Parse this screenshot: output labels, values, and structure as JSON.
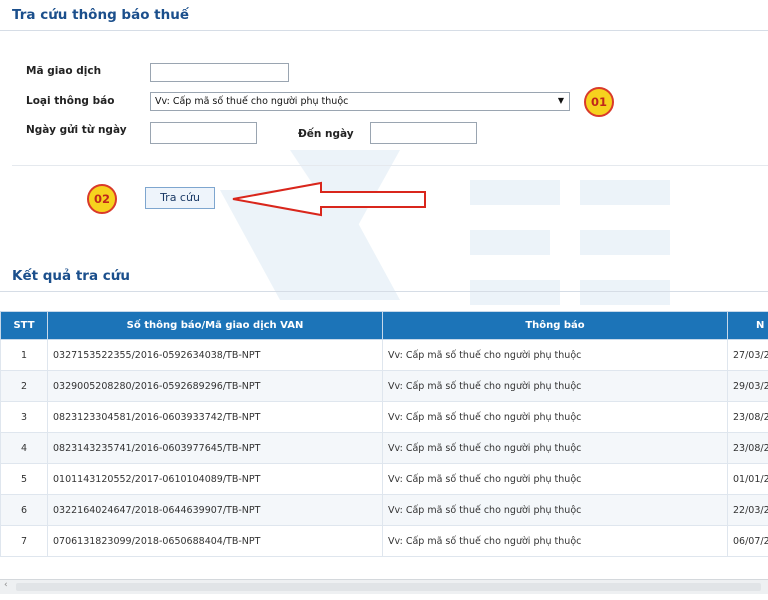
{
  "search": {
    "title": "Tra cứu thông báo thuế",
    "ma_giao_dich_label": "Mã giao dịch",
    "ma_giao_dich_value": "",
    "loai_thong_bao_label": "Loại thông báo",
    "loai_thong_bao_value": "Vv: Cấp mã số thuế cho người phụ thuộc",
    "ngay_gui_label": "Ngày gửi từ ngày",
    "den_ngay_label": "Đến ngày",
    "tu_ngay_value": "",
    "den_ngay_value": "",
    "button_label": "Tra cứu",
    "badge_1": "01",
    "badge_2": "02"
  },
  "results": {
    "title": "Kết quả tra cứu",
    "columns": [
      "STT",
      "Số thông báo/Mã giao dịch VAN",
      "Thông báo",
      "N"
    ],
    "rows": [
      {
        "stt": "1",
        "so": "0327153522355/2016-0592634038/TB-NPT",
        "tb": "Vv: Cấp mã số thuế cho người phụ thuộc",
        "ngay": "27/03/2"
      },
      {
        "stt": "2",
        "so": "0329005208280/2016-0592689296/TB-NPT",
        "tb": "Vv: Cấp mã số thuế cho người phụ thuộc",
        "ngay": "29/03/2"
      },
      {
        "stt": "3",
        "so": "0823123304581/2016-0603933742/TB-NPT",
        "tb": "Vv: Cấp mã số thuế cho người phụ thuộc",
        "ngay": "23/08/2"
      },
      {
        "stt": "4",
        "so": "0823143235741/2016-0603977645/TB-NPT",
        "tb": "Vv: Cấp mã số thuế cho người phụ thuộc",
        "ngay": "23/08/2"
      },
      {
        "stt": "5",
        "so": "0101143120552/2017-0610104089/TB-NPT",
        "tb": "Vv: Cấp mã số thuế cho người phụ thuộc",
        "ngay": "01/01/2"
      },
      {
        "stt": "6",
        "so": "0322164024647/2018-0644639907/TB-NPT",
        "tb": "Vv: Cấp mã số thuế cho người phụ thuộc",
        "ngay": "22/03/2"
      },
      {
        "stt": "7",
        "so": "0706131823099/2018-0650688404/TB-NPT",
        "tb": "Vv: Cấp mã số thuế cho người phụ thuộc",
        "ngay": "06/07/2"
      }
    ]
  },
  "colors": {
    "accent": "#1b4f8c",
    "header_bg": "#1c74b8",
    "badge_fill": "#f6d21e",
    "badge_border": "#d93a2a",
    "arrow": "#d9261c"
  }
}
